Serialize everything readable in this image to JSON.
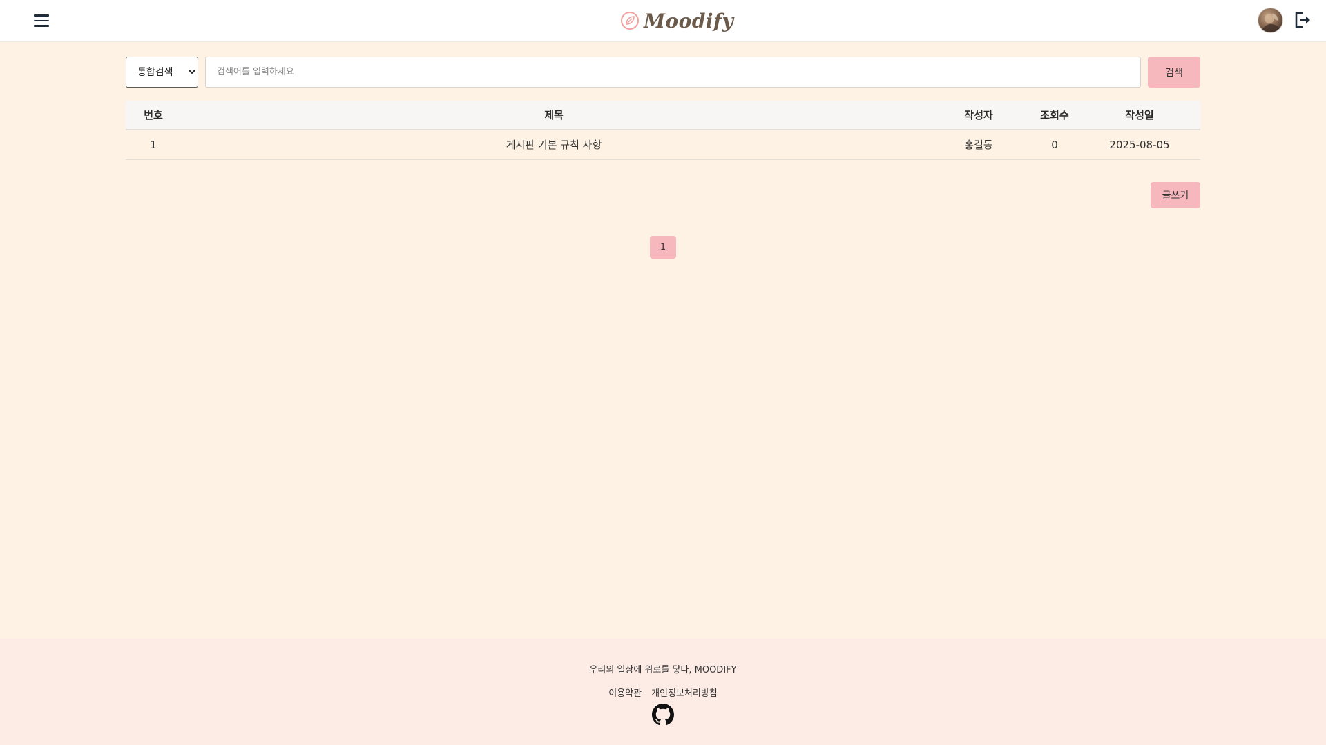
{
  "header": {
    "brand": "Moodify",
    "menu_icon": "hamburger-menu-icon",
    "profile_icon": "user-avatar",
    "logout_icon": "logout-icon"
  },
  "search": {
    "select_options": [
      "통합검색"
    ],
    "selected": "통합검색",
    "placeholder": "검색어를 입력하세요",
    "value": "",
    "button_label": "검색"
  },
  "table": {
    "headers": {
      "no": "번호",
      "title": "제목",
      "author": "작성자",
      "views": "조회수",
      "date": "작성일"
    },
    "rows": [
      {
        "no": "1",
        "title": "게시판 기본 규칙 사항",
        "author": "홍길동",
        "views": "0",
        "date": "2025-08-05"
      }
    ]
  },
  "actions": {
    "write_label": "글쓰기"
  },
  "pagination": {
    "current": "1"
  },
  "footer": {
    "tagline": "우리의 일상에 위로를 닿다, MOODIFY",
    "terms": "이용약관",
    "privacy": "개인정보처리방침",
    "github_icon": "github-icon"
  },
  "colors": {
    "page_bg": "#fdf2e3",
    "accent_pink": "#f6b7bd",
    "footer_bg": "#fdece6",
    "header_bg": "#ffffff"
  }
}
